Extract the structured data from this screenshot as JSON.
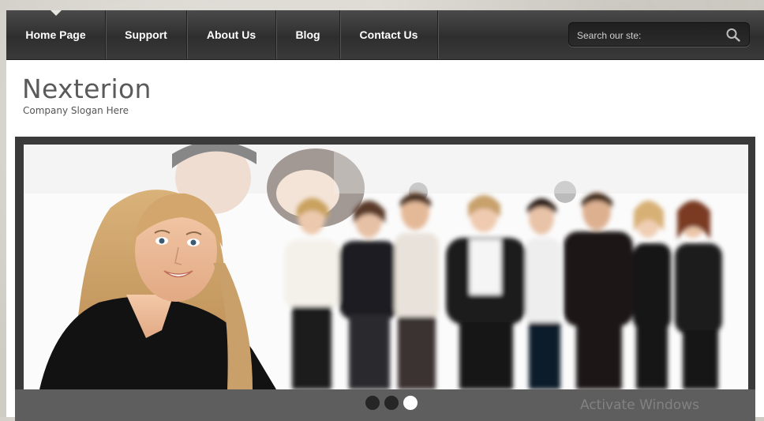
{
  "nav": {
    "items": [
      {
        "label": "Home Page"
      },
      {
        "label": "Support"
      },
      {
        "label": "About Us"
      },
      {
        "label": "Blog"
      },
      {
        "label": "Contact Us"
      }
    ],
    "active_index": 0
  },
  "search": {
    "placeholder": "Search our ste:"
  },
  "header": {
    "logo": "Nexterion",
    "slogan": "Company Slogan Here"
  },
  "slider": {
    "slide_count": 3,
    "active_slide": 3
  },
  "overlay": {
    "watermark": "Activate Windows"
  },
  "colors": {
    "nav_bg": "#3a3a3a",
    "slider_frame": "#3a3a3a",
    "dot_active": "#ffffff",
    "dot_inactive": "#262626"
  }
}
